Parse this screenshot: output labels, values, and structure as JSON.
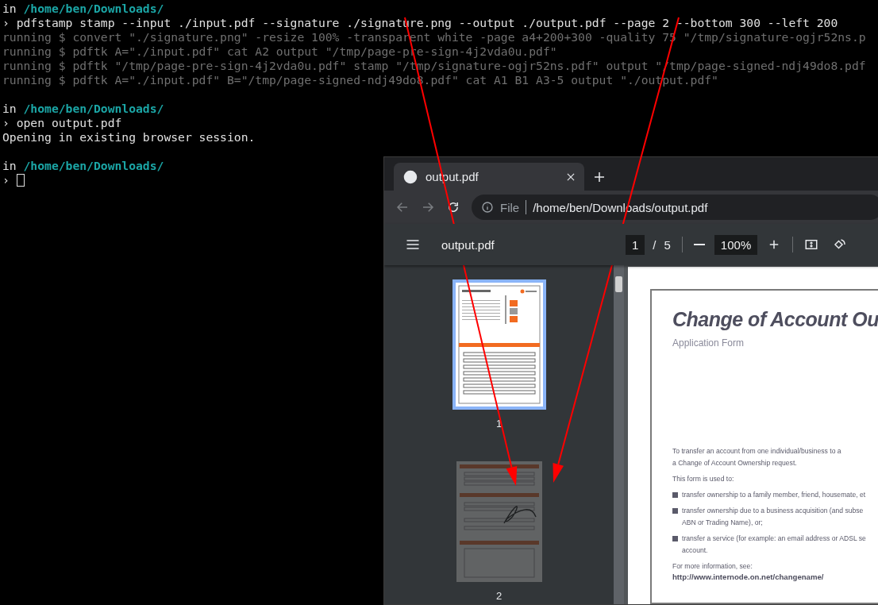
{
  "terminal": {
    "blocks": [
      {
        "prefix": "in",
        "dir": "/home/ben/Downloads/",
        "lines": [
          {
            "kind": "command",
            "marker": "›",
            "text": "pdfstamp stamp --input ./input.pdf --signature ./signature.png --output ./output.pdf --page 2 --bottom 300 --left 200"
          },
          {
            "kind": "output",
            "text": "running $ convert \"./signature.png\" -resize 100% -transparent white -page a4+200+300 -quality 75 \"/tmp/signature-ogjr52ns.p"
          },
          {
            "kind": "output",
            "text": "running $ pdftk A=\"./input.pdf\" cat A2 output \"/tmp/page-pre-sign-4j2vda0u.pdf\""
          },
          {
            "kind": "output",
            "text": "running $ pdftk \"/tmp/page-pre-sign-4j2vda0u.pdf\" stamp \"/tmp/signature-ogjr52ns.pdf\" output \"/tmp/page-signed-ndj49do8.pdf"
          },
          {
            "kind": "output",
            "text": "running $ pdftk A=\"./input.pdf\" B=\"/tmp/page-signed-ndj49do8.pdf\" cat A1 B1 A3-5 output \"./output.pdf\""
          }
        ]
      },
      {
        "prefix": "in",
        "dir": "/home/ben/Downloads/",
        "lines": [
          {
            "kind": "command",
            "marker": "›",
            "text": "open output.pdf"
          },
          {
            "kind": "output_plain",
            "text": "Opening in existing browser session."
          }
        ]
      },
      {
        "prefix": "in",
        "dir": "/home/ben/Downloads/",
        "lines": [
          {
            "kind": "prompt",
            "marker": "›",
            "cursor": true
          }
        ]
      }
    ]
  },
  "browser": {
    "tab": {
      "title": "output.pdf",
      "selected": true
    },
    "address": {
      "scheme": "File",
      "url": "/home/ben/Downloads/output.pdf"
    },
    "pdf_toolbar": {
      "title": "output.pdf",
      "page": "1",
      "separator": "/",
      "total": "5",
      "zoom": "100%"
    },
    "thumbnails": [
      {
        "label": "1",
        "selected": true,
        "kind": "form"
      },
      {
        "label": "2",
        "selected": false,
        "kind": "signed"
      }
    ],
    "document": {
      "title": "Change of Account Ou",
      "subtitle": "Application Form",
      "intro": [
        "To transfer an account from one individual/business to a",
        "a Change of Account Ownership request."
      ],
      "lead": "This form is used to:",
      "bullets": [
        {
          "lines": [
            "transfer ownership to a family member, friend, housemate, et"
          ]
        },
        {
          "lines": [
            "transfer ownership due to a business acquisition (and subse",
            "ABN or Trading Name), or;"
          ]
        },
        {
          "lines": [
            "transfer a service (for example: an email address or ADSL se",
            "account."
          ]
        }
      ],
      "more": "For more information, see:",
      "link": "http://www.internode.on.net/changename/"
    }
  },
  "annotations": [
    {
      "kind": "arrow"
    },
    {
      "kind": "arrow"
    }
  ]
}
